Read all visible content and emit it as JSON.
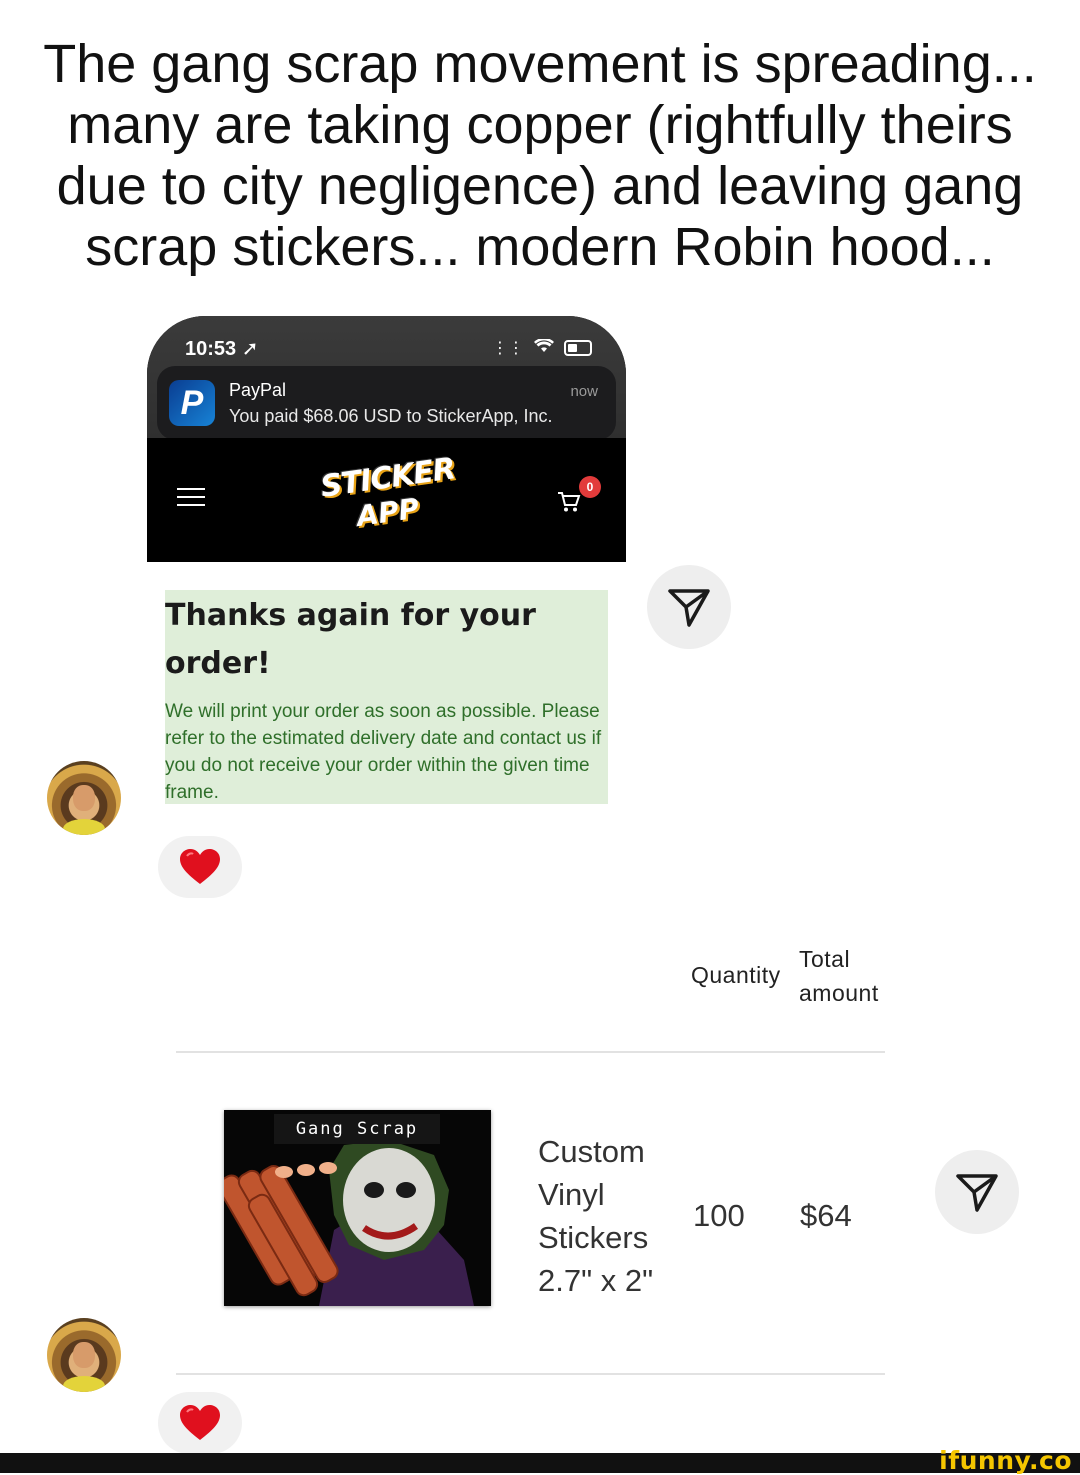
{
  "caption": "The gang scrap movement is spreading... many are taking copper (rightfully theirs due to city negligence) and leaving gang scrap stickers... modern Robin hood...",
  "phone": {
    "time": "10:53",
    "notification": {
      "app": "PayPal",
      "time": "now",
      "body": "You paid $68.06 USD to StickerApp, Inc."
    },
    "brand_line1": "STICKER",
    "brand_line2": "APP",
    "cart_count": "0"
  },
  "thanks": {
    "heading": "Thanks again for your order!",
    "body": "We will print your order as soon as possible. Please refer to the estimated delivery date and contact us if you do not receive your order within the given time frame."
  },
  "table": {
    "quantity_header": "Quantity",
    "total_header_line1": "Total",
    "total_header_line2": "amount",
    "product_label": "Gang Scrap",
    "product_name": "Custom Vinyl Stickers 2.7\" x 2\"",
    "quantity": "100",
    "amount": "$64"
  },
  "watermark": "ifunny.co",
  "colors": {
    "thanks_bg": "#dfeed9",
    "thanks_text": "#2f6f2a",
    "heart": "#e0101e",
    "watermark": "#f5c600"
  },
  "icons": [
    "send-icon",
    "heart-icon",
    "hamburger-icon",
    "cart-icon",
    "paypal-icon",
    "wifi-icon",
    "battery-icon",
    "location-arrow-icon"
  ]
}
